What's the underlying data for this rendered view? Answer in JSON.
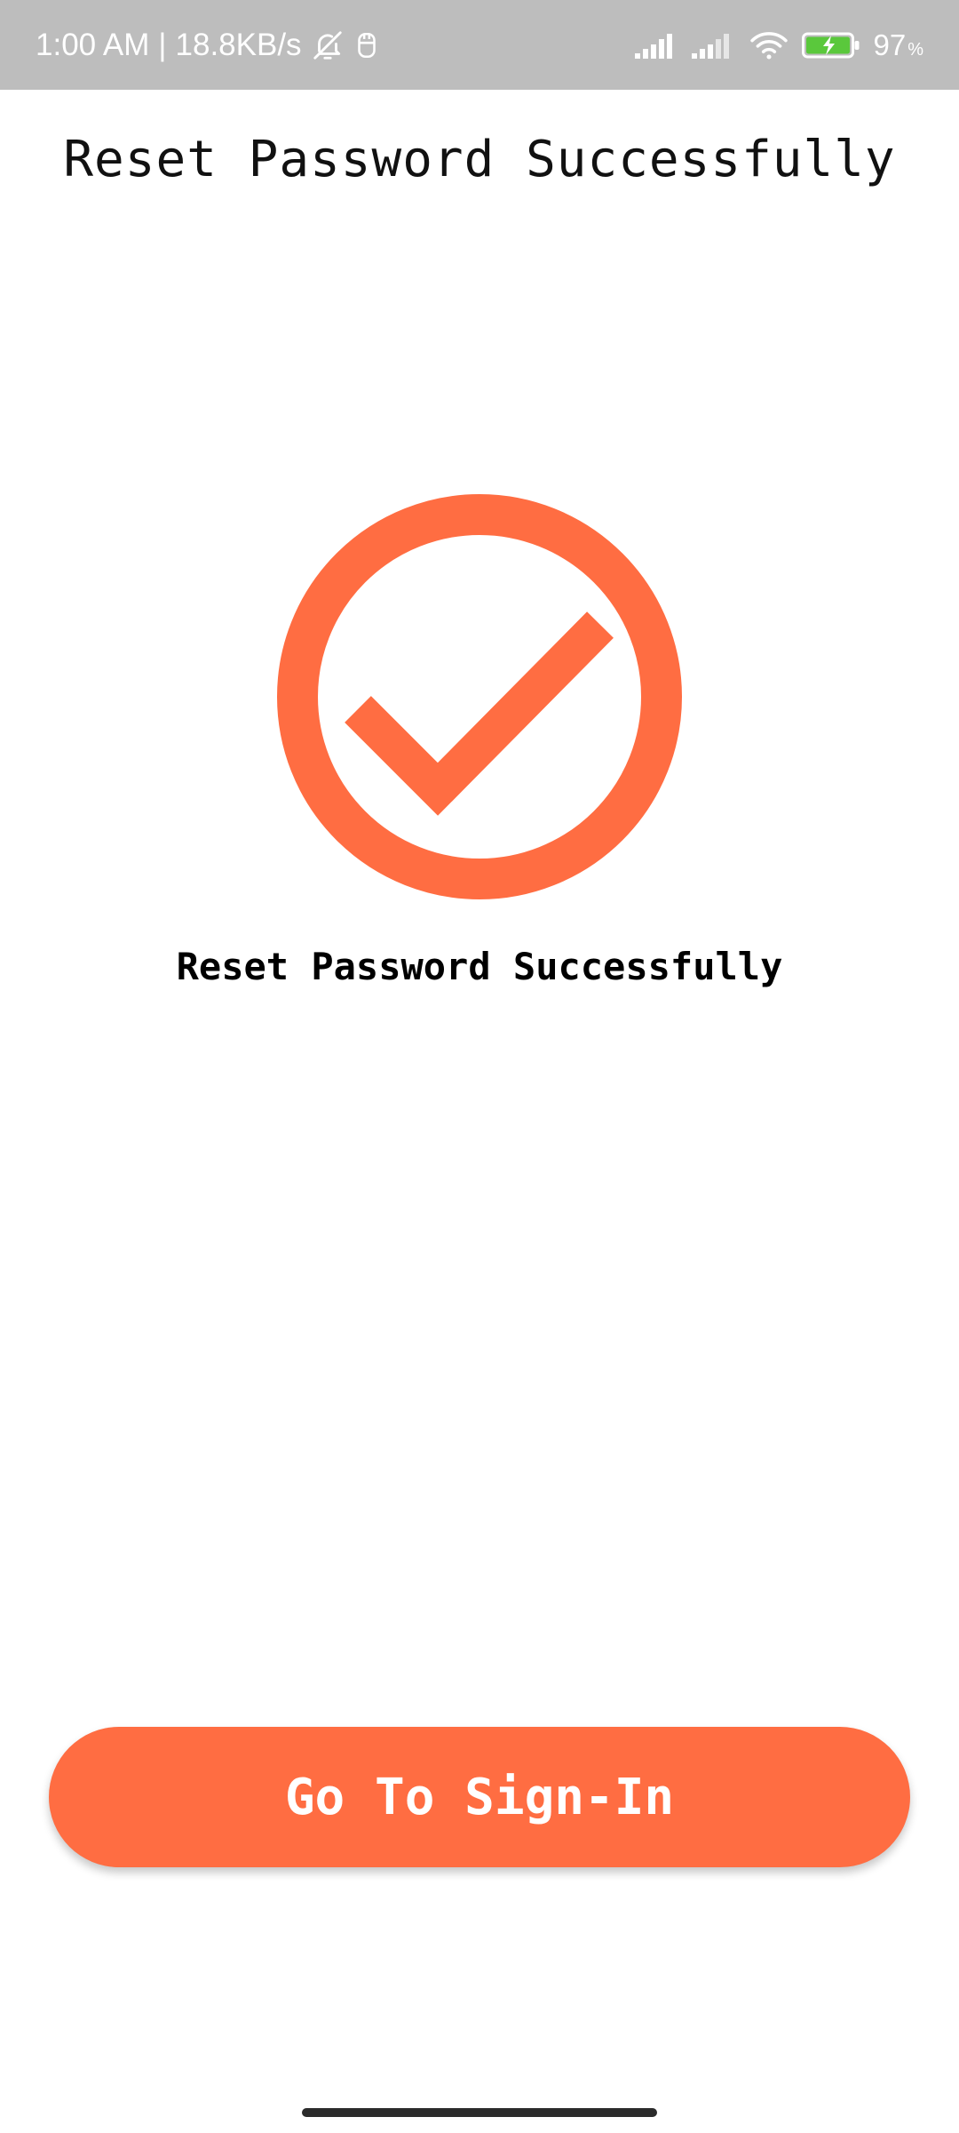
{
  "status_bar": {
    "time": "1:00 AM",
    "separator": "|",
    "network_speed": "18.8KB/s",
    "battery_percent": "97",
    "battery_percent_sign": "%",
    "icons": [
      "bell-off-icon",
      "notification-app-icon",
      "signal-icon",
      "signal-icon",
      "wifi-icon",
      "battery-charging-icon"
    ]
  },
  "header": {
    "title": "Reset Password Successfully"
  },
  "main": {
    "success_icon": "check-circle-icon",
    "message": "Reset Password Successfully"
  },
  "actions": {
    "sign_in_button_label": "Go To Sign-In"
  },
  "colors": {
    "accent": "#ff6d42",
    "status_bar_bg": "#bdbdbd",
    "background": "#ffffff",
    "battery_fill": "#5ac83c"
  }
}
